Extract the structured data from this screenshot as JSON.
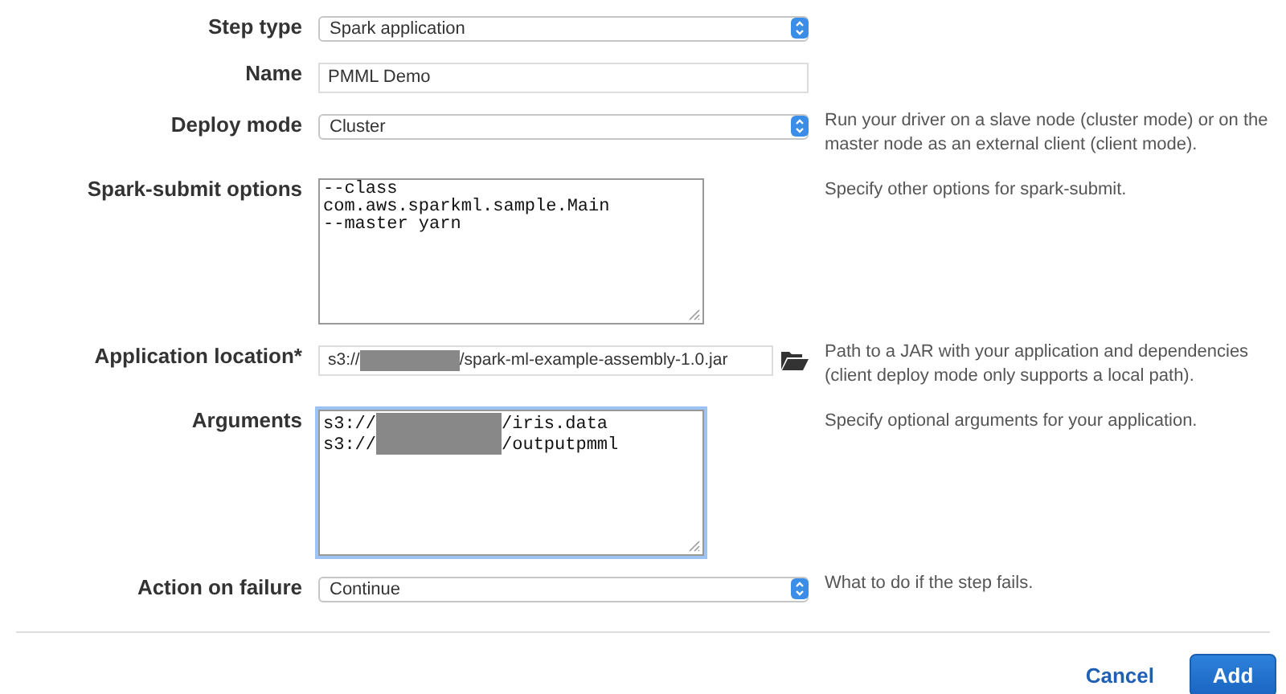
{
  "fields": [
    {
      "kind": "select",
      "label": "Step type",
      "value": [
        "Spark application"
      ]
    },
    {
      "kind": "input",
      "label": "Name",
      "value": [
        "PMML Demo"
      ]
    },
    {
      "kind": "select",
      "label": "Deploy mode",
      "value": [
        "Cluster"
      ],
      "help": "Run your driver on a slave node (cluster mode) or on the master node as an external client (client mode)."
    },
    {
      "kind": "textarea",
      "label": "Spark-submit options",
      "focused": false,
      "lines": [
        [
          "--class"
        ],
        [
          "com.aws.sparkml.sample.Main"
        ],
        [
          "--master yarn"
        ]
      ],
      "help": "Specify other options for spark-submit."
    },
    {
      "kind": "file",
      "label": "Application location*",
      "value": [
        "s3://",
        "/spark-ml-example-assembly-1.0.jar"
      ],
      "help": "Path to a JAR with your application and dependencies (client deploy mode only supports a local path)."
    },
    {
      "kind": "textarea",
      "label": "Arguments",
      "focused": true,
      "lines": [
        [
          "s3://",
          "/iris.data"
        ],
        [
          "s3://",
          "/outputpmml"
        ]
      ],
      "help": "Specify optional arguments for your application."
    },
    {
      "kind": "select",
      "label": "Action on failure",
      "value": [
        "Continue"
      ],
      "help": "What to do if the step fails."
    }
  ],
  "buttons": {
    "cancel": "Cancel",
    "add": "Add"
  }
}
